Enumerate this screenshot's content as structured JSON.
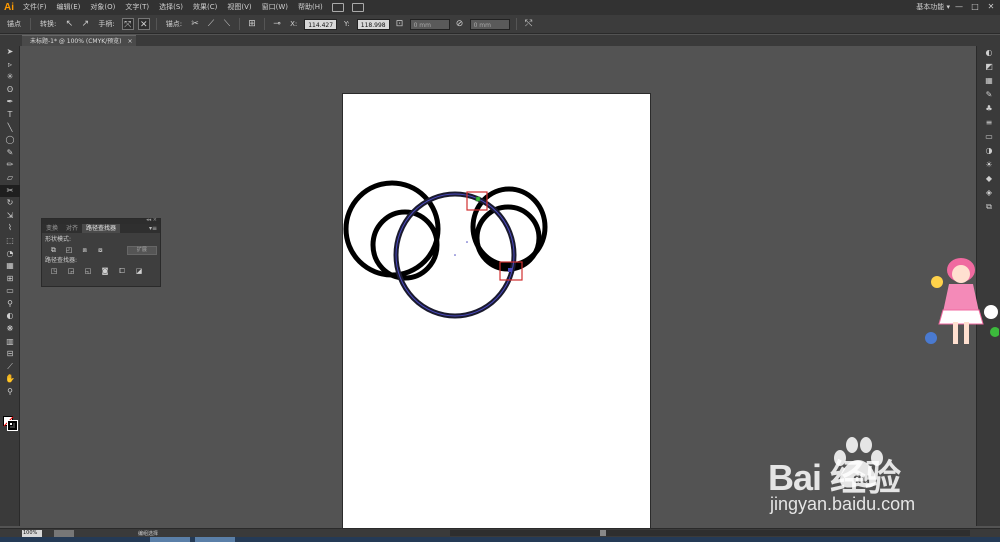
{
  "app": {
    "logo": "Ai",
    "workspace": "基本功能 ▾"
  },
  "menu": {
    "items": [
      "文件(F)",
      "编辑(E)",
      "对象(O)",
      "文字(T)",
      "选择(S)",
      "效果(C)",
      "视图(V)",
      "窗口(W)",
      "帮助(H)"
    ]
  },
  "window_controls": {
    "minimize": "—",
    "maximize": "□",
    "close": "✕"
  },
  "control_bar": {
    "anchor_label": "锚点",
    "convert_label": "转换:",
    "handle_label": "手柄:",
    "anchor2_label": "锚点:",
    "x_value": "114.427",
    "y_value": "118.998",
    "w_value": "0 mm",
    "h_value": "0 mm",
    "x_unit": "X:",
    "y_unit": "Y:"
  },
  "document": {
    "tab_title": "未标题-1* @ 100% (CMYK/预览)",
    "tab_close": "×"
  },
  "tools": [
    "selection-tool",
    "direct-selection-tool",
    "magic-wand-tool",
    "lasso-tool",
    "pen-tool",
    "type-tool",
    "line-tool",
    "ellipse-tool",
    "paintbrush-tool",
    "pencil-tool",
    "eraser-tool",
    "scissors-tool",
    "rotate-tool",
    "scale-tool",
    "warp-tool",
    "free-transform-tool",
    "shape-builder-tool",
    "perspective-grid-tool",
    "mesh-tool",
    "gradient-tool",
    "eyedropper-tool",
    "blend-tool",
    "symbol-sprayer-tool",
    "column-graph-tool",
    "artboard-tool",
    "slice-tool",
    "hand-tool",
    "zoom-tool"
  ],
  "pathfinder_panel": {
    "tabs": [
      "变换",
      "对齐",
      "路径查找器"
    ],
    "active_tab": 2,
    "shape_modes_label": "形状模式:",
    "pathfinders_label": "路径查找器:",
    "expand_label": "扩展",
    "collapse": "◂◂",
    "close": "×",
    "menu": "▾≡"
  },
  "status": {
    "zoom": "100%",
    "mode": "编组选择"
  },
  "watermark": {
    "brand": "Bai  经验",
    "url": "jingyan.baidu.com"
  },
  "colors": {
    "accent": "#ff9a00",
    "ui_dark": "#323232",
    "ui_mid": "#3c3c3c",
    "canvas_bg": "#535353",
    "stroke": "#000000",
    "path_highlight": "#3a3aa0",
    "marker_red": "#d03030",
    "anchor_green": "#3cba3c"
  }
}
